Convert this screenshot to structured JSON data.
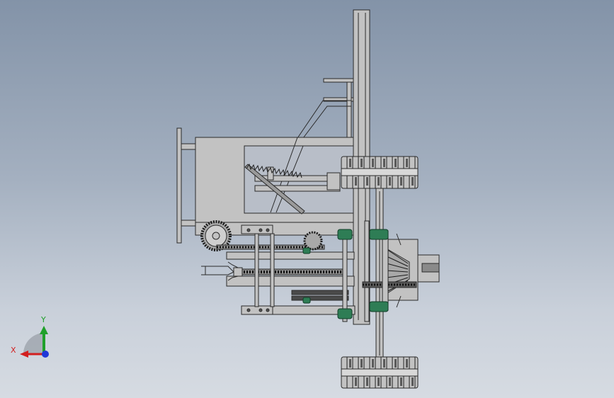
{
  "viewport": {
    "background_top": "#8393a8",
    "background_bottom": "#d6dbe2"
  },
  "model": {
    "part_fill": "#c2c2c2",
    "part_stroke": "#2a2a2a",
    "bearing_color": "#2e7d55"
  },
  "triad": {
    "x_label": "X",
    "y_label": "Y",
    "x_color": "#d21f1f",
    "y_color": "#1fa02a",
    "z_color": "#2038d8"
  }
}
